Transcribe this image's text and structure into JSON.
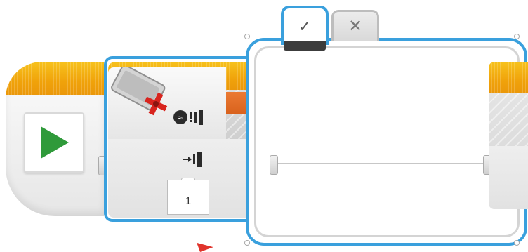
{
  "start_block": {
    "icon": "play-icon"
  },
  "switch_block": {
    "sensor_icon": "touch-sensor-icon",
    "mode_icon": "compare-state-icon",
    "input_icon": "input-state-icon",
    "port": "1",
    "state_value": "1"
  },
  "case_tabs": {
    "true_label": "✓",
    "false_label": "✕"
  },
  "colors": {
    "accent_blue": "#3aa0dd",
    "block_orange": "#f0a20a",
    "port_orange": "#e06a25",
    "play_green": "#2f9a3a"
  }
}
